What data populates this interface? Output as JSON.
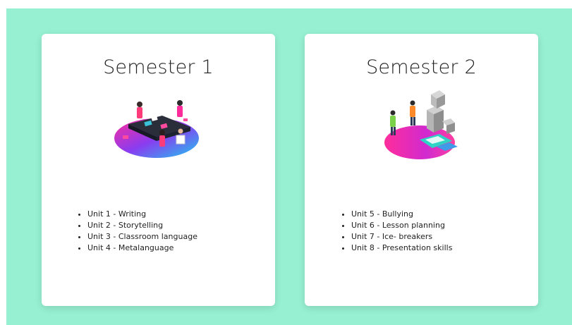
{
  "background_color": "#97f0d2",
  "semesters": [
    {
      "title": "Semester 1",
      "illustration": "people-collaborating-at-table-illustration",
      "units": [
        "Unit 1 - Writing",
        "Unit 2 - Storytelling",
        "Unit 3 - Classroom language",
        "Unit 4 - Metalanguage"
      ]
    },
    {
      "title": "Semester 2",
      "illustration": "people-stacking-blocks-illustration",
      "units": [
        "Unit 5 - Bullying",
        "Unit 6 - Lesson planning",
        "Unit 7 - Ice- breakers",
        "Unit 8 - Presentation skills"
      ]
    }
  ]
}
